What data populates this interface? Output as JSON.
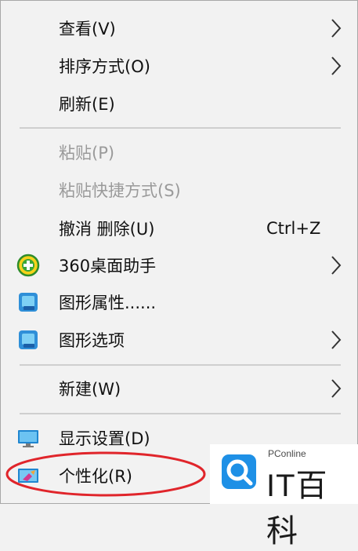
{
  "menu": {
    "items": [
      {
        "label": "查看(V)",
        "submenu": true
      },
      {
        "label": "排序方式(O)",
        "submenu": true
      },
      {
        "label": "刷新(E)"
      },
      {
        "label": "粘贴(P)",
        "disabled": true
      },
      {
        "label": "粘贴快捷方式(S)",
        "disabled": true
      },
      {
        "label": "撤消 删除(U)",
        "shortcut": "Ctrl+Z"
      },
      {
        "label": "360桌面助手",
        "icon": "360-assistant-icon",
        "submenu": true
      },
      {
        "label": "图形属性......",
        "icon": "graphics-properties-icon"
      },
      {
        "label": "图形选项",
        "icon": "graphics-options-icon",
        "submenu": true
      },
      {
        "label": "新建(W)",
        "submenu": true
      },
      {
        "label": "显示设置(D)",
        "icon": "display-settings-icon"
      },
      {
        "label": "个性化(R)",
        "icon": "personalize-icon",
        "highlighted": true
      }
    ]
  },
  "watermark": {
    "small_text": "PConline",
    "big_text": "IT百科"
  },
  "colors": {
    "menu_background": "#f2f2f2",
    "text": "#111111",
    "disabled_text": "#9a9a9a",
    "separator": "#cfcfcf",
    "highlight_ellipse": "#e0252b",
    "watermark_blue": "#1e90e6"
  }
}
